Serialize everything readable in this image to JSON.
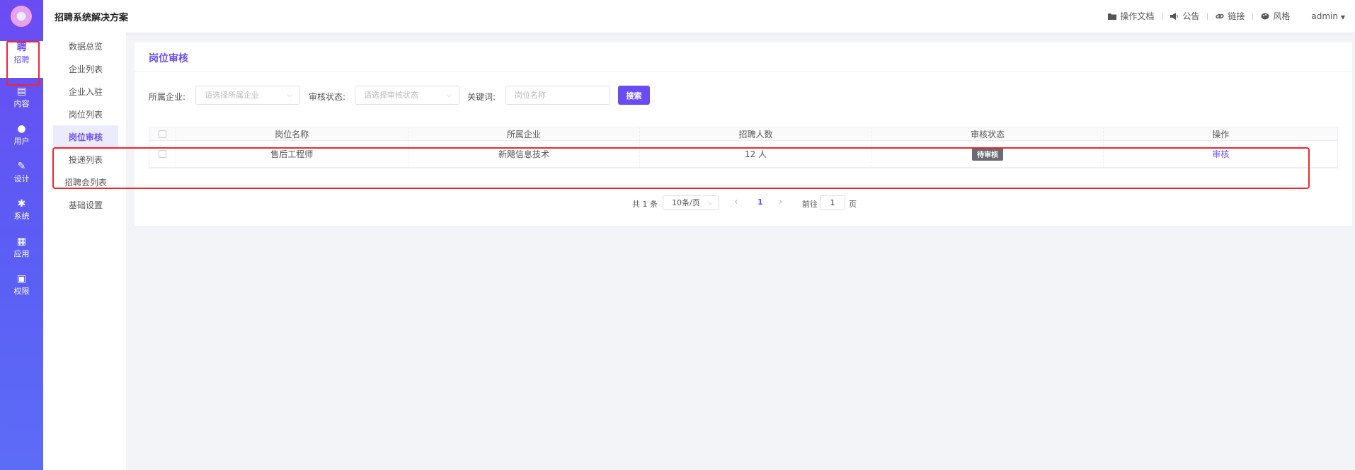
{
  "app": {
    "title": "招聘系统解决方案"
  },
  "header": {
    "links": [
      {
        "icon": "folder-icon",
        "label": "操作文档"
      },
      {
        "icon": "megaphone-icon",
        "label": "公告"
      },
      {
        "icon": "link-icon",
        "label": "链接"
      },
      {
        "icon": "palette-icon",
        "label": "风格"
      }
    ],
    "user": "admin"
  },
  "rail": {
    "items": [
      {
        "icon": "聘",
        "label": "招聘"
      },
      {
        "icon": "▤",
        "label": "内容"
      },
      {
        "icon": "●",
        "label": "用户"
      },
      {
        "icon": "✎",
        "label": "设计"
      },
      {
        "icon": "✱",
        "label": "系统"
      },
      {
        "icon": "▦",
        "label": "应用"
      },
      {
        "icon": "▣",
        "label": "权限"
      }
    ]
  },
  "subnav": {
    "items": [
      "数据总览",
      "企业列表",
      "企业入驻",
      "岗位列表",
      "岗位审核",
      "投递列表",
      "招聘会列表",
      "基础设置"
    ]
  },
  "page": {
    "title": "岗位审核"
  },
  "filters": {
    "company_label": "所属企业:",
    "company_placeholder": "请选择所属企业",
    "status_label": "审核状态:",
    "status_placeholder": "请选择审核状态",
    "keyword_label": "关键词:",
    "keyword_placeholder": "岗位名称",
    "search_label": "搜索"
  },
  "table": {
    "columns": [
      "岗位名称",
      "所属企业",
      "招聘人数",
      "审核状态",
      "操作"
    ],
    "rows": [
      {
        "name": "售后工程师",
        "company": "新飓信息技术",
        "count": "12 人",
        "status": "待审核",
        "action": "审核"
      }
    ]
  },
  "pagination": {
    "total": "共 1 条",
    "page_size": "10条/页",
    "current": "1",
    "goto_label": "前往",
    "goto_value": "1",
    "page_suffix": "页"
  },
  "colors": {
    "accent": "#6a4cf3",
    "highlight": "#f0262c"
  }
}
